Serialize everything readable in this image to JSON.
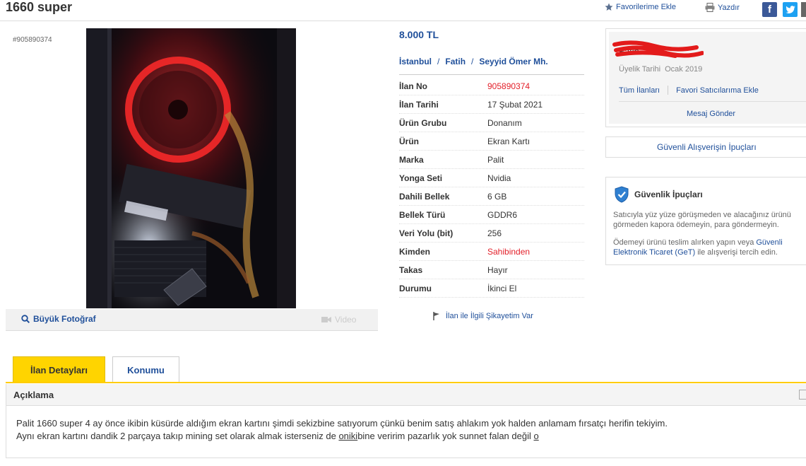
{
  "header": {
    "title": "1660 super",
    "favorite_label": "Favorilerime Ekle",
    "print_label": "Yazdır",
    "facebook": "f",
    "twitter": "t"
  },
  "listing": {
    "id_small": "#905890374",
    "price": "8.000 TL",
    "location": {
      "city": "İstanbul",
      "district": "Fatih",
      "neighborhood": "Seyyid Ömer Mh."
    },
    "details": [
      {
        "label": "İlan No",
        "value": "905890374"
      },
      {
        "label": "İlan Tarihi",
        "value": "17 Şubat 2021"
      },
      {
        "label": "Ürün Grubu",
        "value": "Donanım"
      },
      {
        "label": "Ürün",
        "value": "Ekran Kartı"
      },
      {
        "label": "Marka",
        "value": "Palit"
      },
      {
        "label": "Yonga Seti",
        "value": "Nvidia"
      },
      {
        "label": "Dahili Bellek",
        "value": "6 GB"
      },
      {
        "label": "Bellek Türü",
        "value": "GDDR6"
      },
      {
        "label": "Veri Yolu (bit)",
        "value": "256"
      },
      {
        "label": "Kimden",
        "value": "Sahibinden"
      },
      {
        "label": "Takas",
        "value": "Hayır"
      },
      {
        "label": "Durumu",
        "value": "İkinci El"
      }
    ],
    "complaint_label": "İlan ile İlgili Şikayetim Var"
  },
  "photo": {
    "big_photo_label": "Büyük Fotoğraf",
    "video_label": "Video"
  },
  "seller": {
    "name": "Fatih ...bec",
    "member_since_label": "Üyelik Tarihi",
    "member_since_value": "Ocak 2019",
    "all_listings_label": "Tüm İlanları",
    "add_favorite_seller_label": "Favori Satıcılarıma Ekle",
    "send_message_label": "Mesaj Gönder"
  },
  "safe_shopping": {
    "label": "Güvenli Alışverişin İpuçları"
  },
  "security_tips": {
    "title": "Güvenlik İpuçları",
    "tip1": "Satıcıyla yüz yüze görüşmeden ve alacağınız ürünü görmeden kapora ödemeyin, para göndermeyin.",
    "tip2_prefix": "Ödemeyi ürünü teslim alırken yapın veya ",
    "tip2_link": "Güvenli Elektronik Ticaret (GeT)",
    "tip2_suffix": " ile alışverişi tercih edin."
  },
  "tabs": {
    "details": "İlan Detayları",
    "location": "Konumu"
  },
  "description": {
    "title": "Açıklama",
    "line1": "Palit 1660 super 4 ay önce ikibin küsürde aldığım ekran kartını şimdi sekizbine satıyorum çünkü benim satış ahlakım yok halden anlamam fırsatçı herifin tekiyim.",
    "line2_before": "Aynı ekran kartını dandik 2 parçaya takıp mining set olarak almak isterseniz de ",
    "line2_underlined": "oniki",
    "line2_after": "bine veririm pazarlık yok sunnet falan değil ",
    "line2_end": "o"
  },
  "colors": {
    "link_blue": "#1f4f9a",
    "accent_yellow": "#ffd400",
    "alert_red": "#e3202a",
    "facebook_blue": "#3b5998",
    "twitter_blue": "#1da1f2"
  }
}
